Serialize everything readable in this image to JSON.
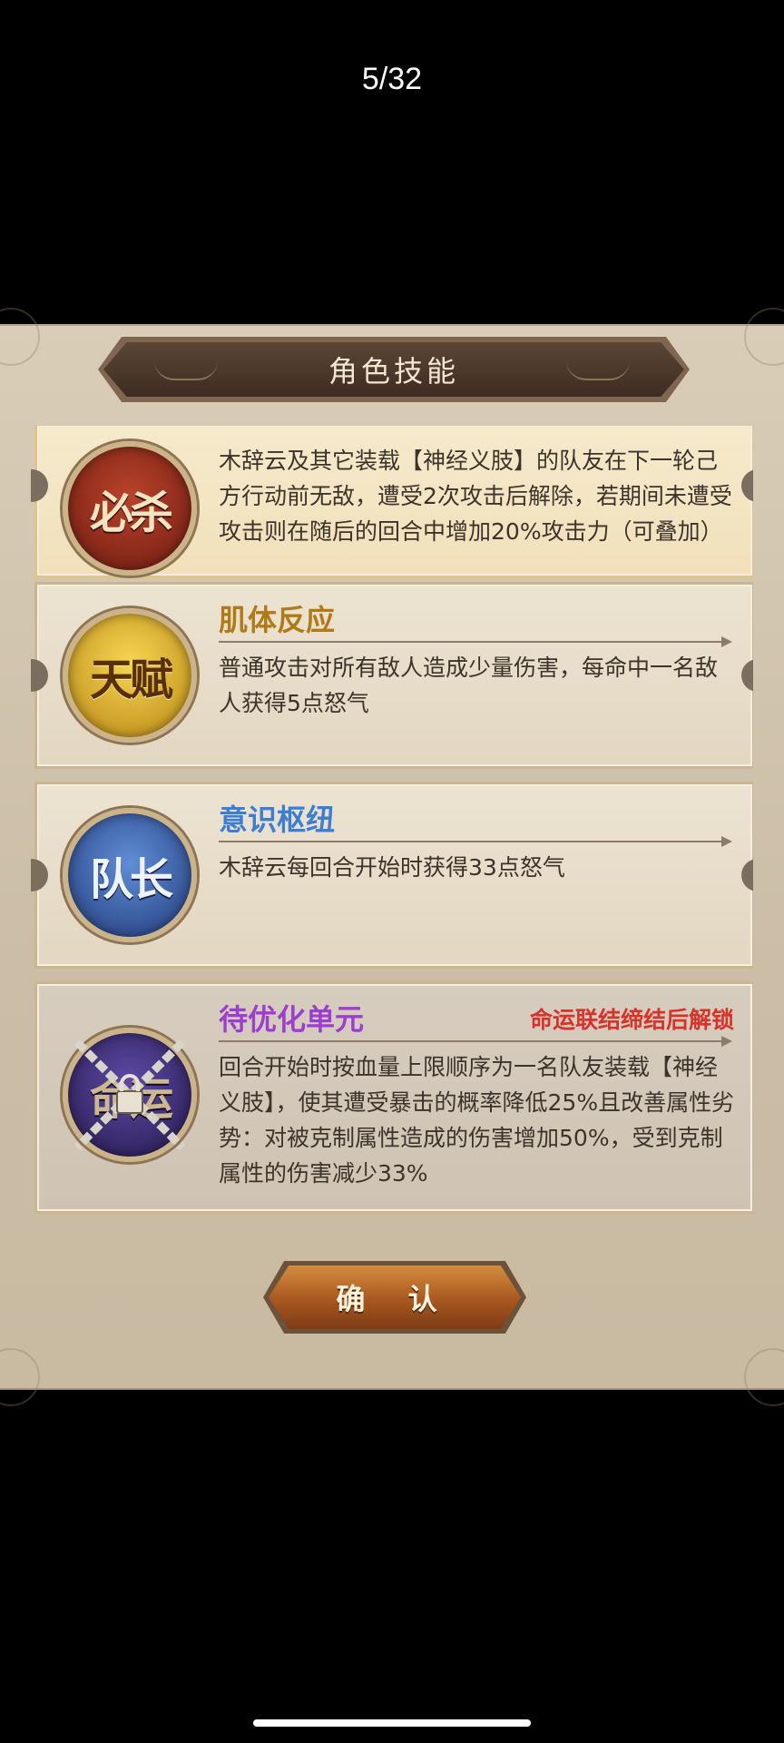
{
  "page_counter": "5/32",
  "panel": {
    "title": "角色技能",
    "confirm_label": "确 认"
  },
  "skills": [
    {
      "badge": "必杀",
      "name": "",
      "description": "木辞云及其它装载【神经义肢】的队友在下一轮己方行动前无敌，遭受2次攻击后解除，若期间未遭受攻击则在随后的回合中增加20%攻击力（可叠加）",
      "badge_color": "#8e2a1a"
    },
    {
      "badge": "天赋",
      "name": "肌体反应",
      "name_color": "#b07a17",
      "description": "普通攻击对所有敌人造成少量伤害，每命中一名敌人获得5点怒气",
      "badge_color": "#d8a82a"
    },
    {
      "badge": "队长",
      "name": "意识枢纽",
      "name_color": "#3c7ed4",
      "description": "木辞云每回合开始时获得33点怒气",
      "badge_color": "#3f62ad"
    },
    {
      "badge": "命运",
      "name": "待优化单元",
      "name_color": "#9b3fcf",
      "unlock_note": "命运联结缔结后解锁",
      "description": "回合开始时按血量上限顺序为一名队友装载【神经义肢】，使其遭受暴击的概率降低25%且改善属性劣势：对被克制属性造成的伤害增加50%，受到克制属性的伤害减少33%",
      "badge_color": "#3b2c73",
      "locked": true
    }
  ]
}
